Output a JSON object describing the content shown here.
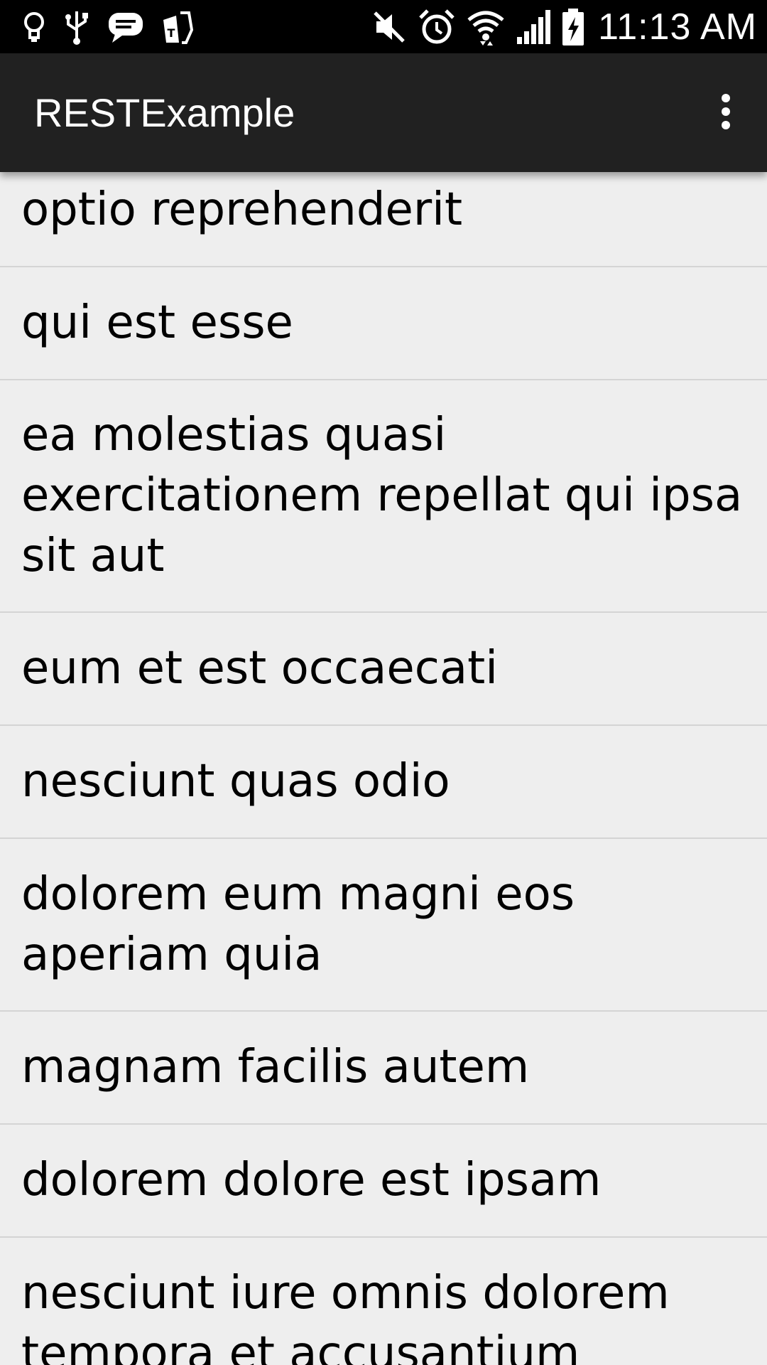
{
  "status_bar": {
    "time": "11:13 AM",
    "left_icons": [
      "lightbulb-icon",
      "usb-icon",
      "message-icon",
      "tmobile-icon"
    ],
    "right_icons": [
      "mute-icon",
      "alarm-icon",
      "wifi-icon",
      "signal-icon",
      "battery-charging-icon"
    ]
  },
  "app_bar": {
    "title": "RESTExample",
    "menu_icon": "overflow-menu-icon"
  },
  "list": {
    "items": [
      {
        "label": "optio reprehenderit"
      },
      {
        "label": "qui est esse"
      },
      {
        "label": "ea molestias quasi exercitationem repellat qui ipsa sit aut"
      },
      {
        "label": "eum et est occaecati"
      },
      {
        "label": "nesciunt quas odio"
      },
      {
        "label": "dolorem eum magni eos aperiam quia"
      },
      {
        "label": "magnam facilis autem"
      },
      {
        "label": "dolorem dolore est ipsam"
      },
      {
        "label": "nesciunt iure omnis dolorem tempora et accusantium"
      }
    ]
  },
  "colors": {
    "status_bar": "#000000",
    "app_bar": "#212121",
    "background": "#eeeeee",
    "divider": "#d4d4d4",
    "text": "#000000"
  }
}
